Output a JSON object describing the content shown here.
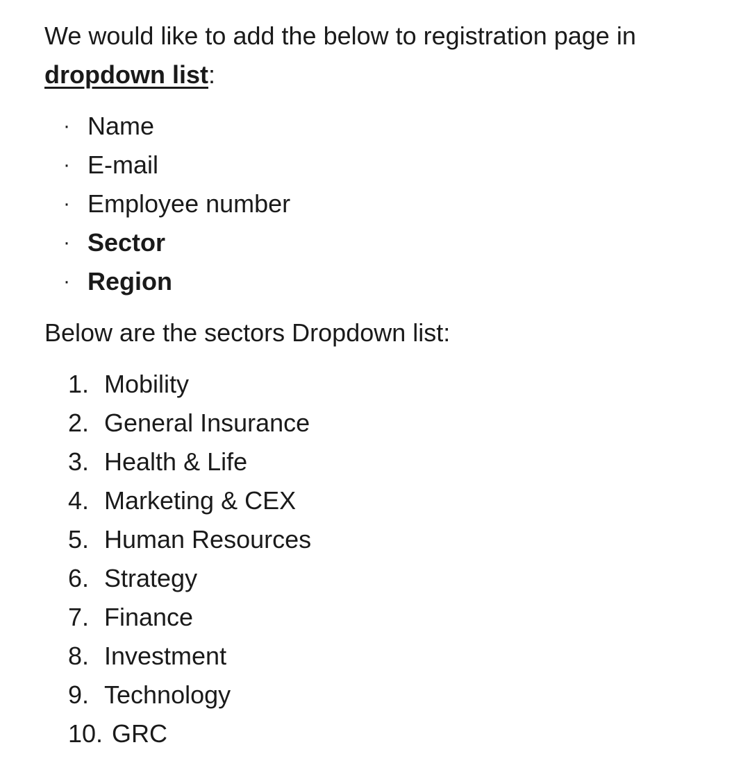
{
  "intro": {
    "text_before": "We would like to add the below to registration page in ",
    "emphasis": "dropdown list",
    "text_after": ":"
  },
  "fields": [
    {
      "bullet": "·",
      "label": "Name",
      "bold": false
    },
    {
      "bullet": "·",
      "label": "E-mail",
      "bold": false
    },
    {
      "bullet": "·",
      "label": "Employee number",
      "bold": false
    },
    {
      "bullet": "·",
      "label": "Sector",
      "bold": true
    },
    {
      "bullet": "·",
      "label": "Region",
      "bold": true
    }
  ],
  "sectors_intro": "Below are the sectors Dropdown list:",
  "sectors": [
    {
      "number": "1.",
      "label": "Mobility"
    },
    {
      "number": "2.",
      "label": "General Insurance"
    },
    {
      "number": "3.",
      "label": "Health & Life"
    },
    {
      "number": "4.",
      "label": "Marketing & CEX"
    },
    {
      "number": "5.",
      "label": "Human Resources"
    },
    {
      "number": "6.",
      "label": "Strategy"
    },
    {
      "number": "7.",
      "label": "Finance"
    },
    {
      "number": "8.",
      "label": "Investment"
    },
    {
      "number": "9.",
      "label": "Technology"
    },
    {
      "number": "10.",
      "label": "GRC"
    }
  ]
}
